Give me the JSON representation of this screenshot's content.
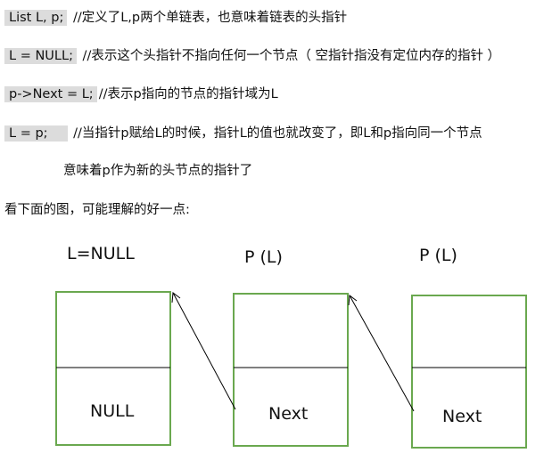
{
  "lines": {
    "l1_code": "List L, p;",
    "l1_comment": " //定义了L,p两个单链表，也意味着链表的头指针",
    "l2_code": "L = NULL;",
    "l2_comment": " //表示这个头指针不指向任何一个节点（ 空指针指没有定位内存的指针 ）",
    "l3_code": "p->Next = L;",
    "l3_comment": "//表示p指向的节点的指针域为L",
    "l4_code": "L = p;",
    "l4_comment": " //当指针p赋给L的时候，指针L的值也就改变了，即L和p指向同一个节点",
    "l5_text": "意味着p作为新的头节点的指针了",
    "l6_text": "看下面的图，可能理解的好一点:"
  },
  "diagram": {
    "nodes": [
      {
        "label": "L=NULL",
        "field": "NULL"
      },
      {
        "label": "P (L)",
        "field": "Next"
      },
      {
        "label": "P (L)",
        "field": "Next"
      }
    ],
    "colors": {
      "box_border": "#6aa84f",
      "divider": "#000000",
      "arrow": "#000000"
    }
  }
}
